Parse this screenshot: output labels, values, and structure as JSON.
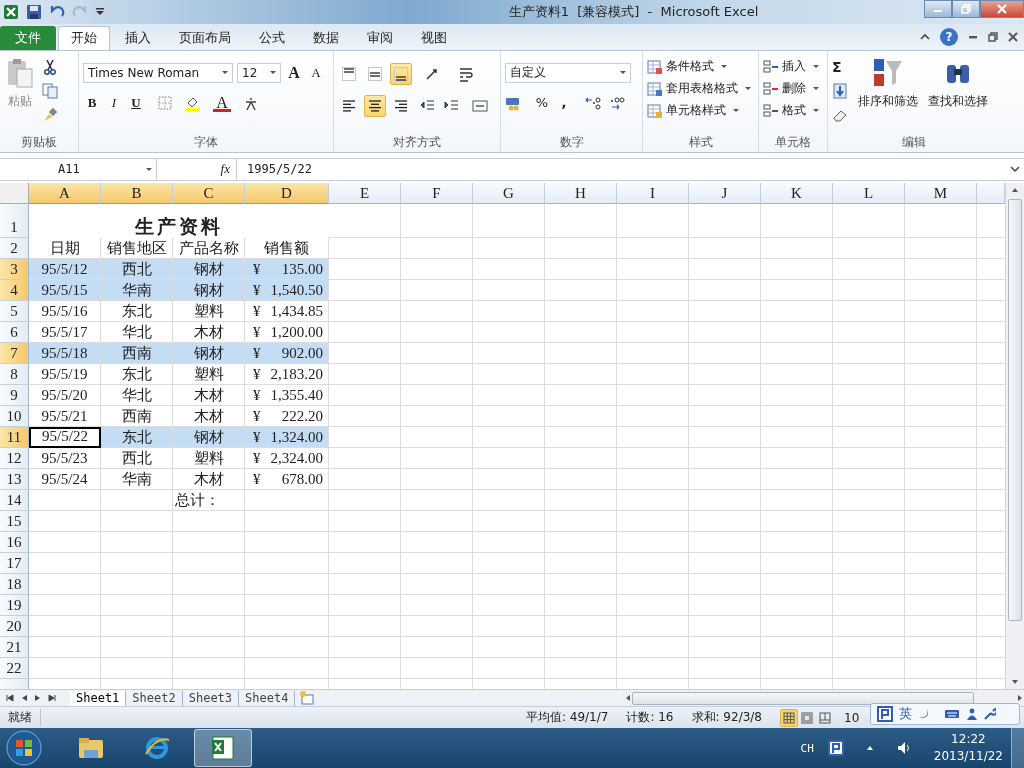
{
  "window": {
    "title": "生产资料1  [兼容模式]  -  Microsoft Excel"
  },
  "ribbon_tabs": [
    {
      "label": "文件",
      "kind": "file",
      "selected": false
    },
    {
      "label": "开始",
      "kind": "tab",
      "selected": true
    },
    {
      "label": "插入",
      "kind": "tab",
      "selected": false
    },
    {
      "label": "页面布局",
      "kind": "tab",
      "selected": false
    },
    {
      "label": "公式",
      "kind": "tab",
      "selected": false
    },
    {
      "label": "数据",
      "kind": "tab",
      "selected": false
    },
    {
      "label": "审阅",
      "kind": "tab",
      "selected": false
    },
    {
      "label": "视图",
      "kind": "tab",
      "selected": false
    }
  ],
  "help_glyph": "?",
  "clipboard": {
    "paste": "粘贴",
    "label": "剪贴板"
  },
  "font": {
    "name": "Times New Roman",
    "size": "12",
    "grow": "A",
    "shrink": "A",
    "bold": "B",
    "italic": "I",
    "underline": "U",
    "font_color": "A",
    "label": "字体"
  },
  "alignment": {
    "vertical": [
      {
        "kind": "top",
        "selected": false
      },
      {
        "kind": "middle",
        "selected": false
      },
      {
        "kind": "bottom",
        "selected": true
      }
    ],
    "horizontal": [
      {
        "kind": "left",
        "selected": false
      },
      {
        "kind": "center",
        "selected": true
      },
      {
        "kind": "right",
        "selected": false
      }
    ],
    "label": "对齐方式"
  },
  "number": {
    "format": "自定义",
    "percent": "%",
    "comma": ",",
    "label": "数字"
  },
  "styles": {
    "items": [
      "条件格式",
      "套用表格格式",
      "单元格样式"
    ],
    "label": "样式"
  },
  "cells": {
    "items": [
      "插入",
      "删除",
      "格式"
    ],
    "label": "单元格"
  },
  "editing": {
    "sum": "Σ",
    "sort": "排序和筛选",
    "find": "查找和选择",
    "label": "编辑"
  },
  "formula_bar": {
    "name_box": "A11",
    "fx": "fx",
    "value": "1995/5/22"
  },
  "columns": [
    {
      "label": "A",
      "selected": true
    },
    {
      "label": "B",
      "selected": true
    },
    {
      "label": "C",
      "selected": true
    },
    {
      "label": "D",
      "selected": true
    },
    {
      "label": "E",
      "selected": false
    },
    {
      "label": "F",
      "selected": false
    },
    {
      "label": "G",
      "selected": false
    },
    {
      "label": "H",
      "selected": false
    },
    {
      "label": "I",
      "selected": false
    },
    {
      "label": "J",
      "selected": false
    },
    {
      "label": "K",
      "selected": false
    },
    {
      "label": "L",
      "selected": false
    },
    {
      "label": "M",
      "selected": false
    }
  ],
  "rows": [
    {
      "label": "1",
      "kind": "title",
      "selected": false,
      "title": "生产资料"
    },
    {
      "label": "2",
      "kind": "header",
      "selected": false,
      "headers": [
        "日期",
        "销售地区",
        "产品名称",
        "销售额"
      ]
    },
    {
      "label": "3",
      "kind": "data",
      "selected": true,
      "active": false,
      "date": "95/5/12",
      "region": "西北",
      "product": "钢材",
      "currency": "¥",
      "amount": "135.00"
    },
    {
      "label": "4",
      "kind": "data",
      "selected": true,
      "active": false,
      "date": "95/5/15",
      "region": "华南",
      "product": "钢材",
      "currency": "¥",
      "amount": "1,540.50"
    },
    {
      "label": "5",
      "kind": "data",
      "selected": false,
      "active": false,
      "date": "95/5/16",
      "region": "东北",
      "product": "塑料",
      "currency": "¥",
      "amount": "1,434.85"
    },
    {
      "label": "6",
      "kind": "data",
      "selected": false,
      "active": false,
      "date": "95/5/17",
      "region": "华北",
      "product": "木材",
      "currency": "¥",
      "amount": "1,200.00"
    },
    {
      "label": "7",
      "kind": "data",
      "selected": true,
      "active": false,
      "date": "95/5/18",
      "region": "西南",
      "product": "钢材",
      "currency": "¥",
      "amount": "902.00"
    },
    {
      "label": "8",
      "kind": "data",
      "selected": false,
      "active": false,
      "date": "95/5/19",
      "region": "东北",
      "product": "塑料",
      "currency": "¥",
      "amount": "2,183.20"
    },
    {
      "label": "9",
      "kind": "data",
      "selected": false,
      "active": false,
      "date": "95/5/20",
      "region": "华北",
      "product": "木材",
      "currency": "¥",
      "amount": "1,355.40"
    },
    {
      "label": "10",
      "kind": "data",
      "selected": false,
      "active": false,
      "date": "95/5/21",
      "region": "西南",
      "product": "木材",
      "currency": "¥",
      "amount": "222.20"
    },
    {
      "label": "11",
      "kind": "data",
      "selected": true,
      "active": true,
      "date": "95/5/22",
      "region": "东北",
      "product": "钢材",
      "currency": "¥",
      "amount": "1,324.00"
    },
    {
      "label": "12",
      "kind": "data",
      "selected": false,
      "active": false,
      "date": "95/5/23",
      "region": "西北",
      "product": "塑料",
      "currency": "¥",
      "amount": "2,324.00"
    },
    {
      "label": "13",
      "kind": "data",
      "selected": false,
      "active": false,
      "date": "95/5/24",
      "region": "华南",
      "product": "木材",
      "currency": "¥",
      "amount": "678.00"
    },
    {
      "label": "14",
      "kind": "total",
      "selected": false,
      "total_label": "总计："
    },
    {
      "label": "15",
      "kind": "empty",
      "selected": false
    },
    {
      "label": "16",
      "kind": "empty",
      "selected": false
    },
    {
      "label": "17",
      "kind": "empty",
      "selected": false
    },
    {
      "label": "18",
      "kind": "empty",
      "selected": false
    },
    {
      "label": "19",
      "kind": "empty",
      "selected": false
    },
    {
      "label": "20",
      "kind": "empty",
      "selected": false
    },
    {
      "label": "21",
      "kind": "empty",
      "selected": false
    },
    {
      "label": "22",
      "kind": "empty",
      "selected": false
    }
  ],
  "sheet_tabs": [
    {
      "label": "Sheet1",
      "selected": true
    },
    {
      "label": "Sheet2",
      "selected": false
    },
    {
      "label": "Sheet3",
      "selected": false
    },
    {
      "label": "Sheet4",
      "selected": false
    }
  ],
  "status_bar": {
    "mode": "就绪",
    "average": "平均值: 49/1/7",
    "count": "计数: 16",
    "sum": "求和: 92/3/8",
    "views": [
      {
        "kind": "normal",
        "selected": true
      },
      {
        "kind": "layout",
        "selected": false
      },
      {
        "kind": "break",
        "selected": false
      }
    ],
    "zoom": "10"
  },
  "ime_bar": {
    "language": "英"
  },
  "taskbar": {
    "apps": [
      {
        "kind": "folder",
        "selected": false
      },
      {
        "kind": "browser",
        "selected": false
      },
      {
        "kind": "spreadsheet",
        "selected": true
      }
    ],
    "input_language": "CH",
    "time": "12:22",
    "date": "2013/11/22"
  }
}
